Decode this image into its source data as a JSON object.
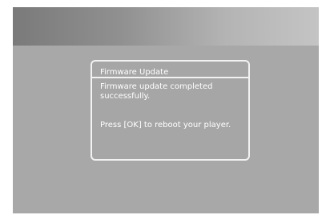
{
  "dialog": {
    "title": "Firmware Update",
    "message": "Firmware update completed successfully.",
    "prompt": "Press [OK] to reboot your player."
  },
  "colors": {
    "screen_background": "#a8a8a8",
    "dialog_border": "#f2f2f2",
    "text": "#ffffff"
  }
}
